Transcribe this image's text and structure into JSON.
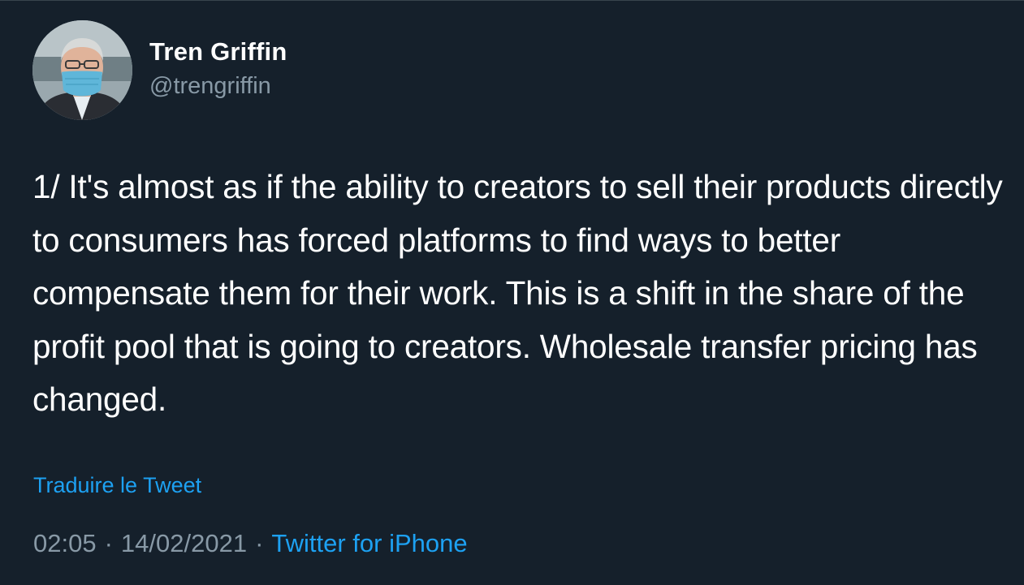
{
  "author": {
    "name": "Tren Griffin",
    "handle": "@trengriffin"
  },
  "tweet": {
    "text": "1/ It's almost as if the ability to creators to sell their products directly to consumers has forced platforms to find ways to better compensate them for their work. This is a shift in the share of the profit pool that is going to creators. Wholesale transfer pricing has changed.",
    "translate_label": "Traduire le Tweet",
    "time": "02:05",
    "date": "14/02/2021",
    "separator": "·",
    "source": "Twitter for iPhone"
  },
  "colors": {
    "background": "#15202b",
    "text": "#ffffff",
    "secondary_text": "#8899a6",
    "accent": "#1da1f2"
  },
  "icons": {
    "avatar": "profile-photo-masked-man"
  }
}
